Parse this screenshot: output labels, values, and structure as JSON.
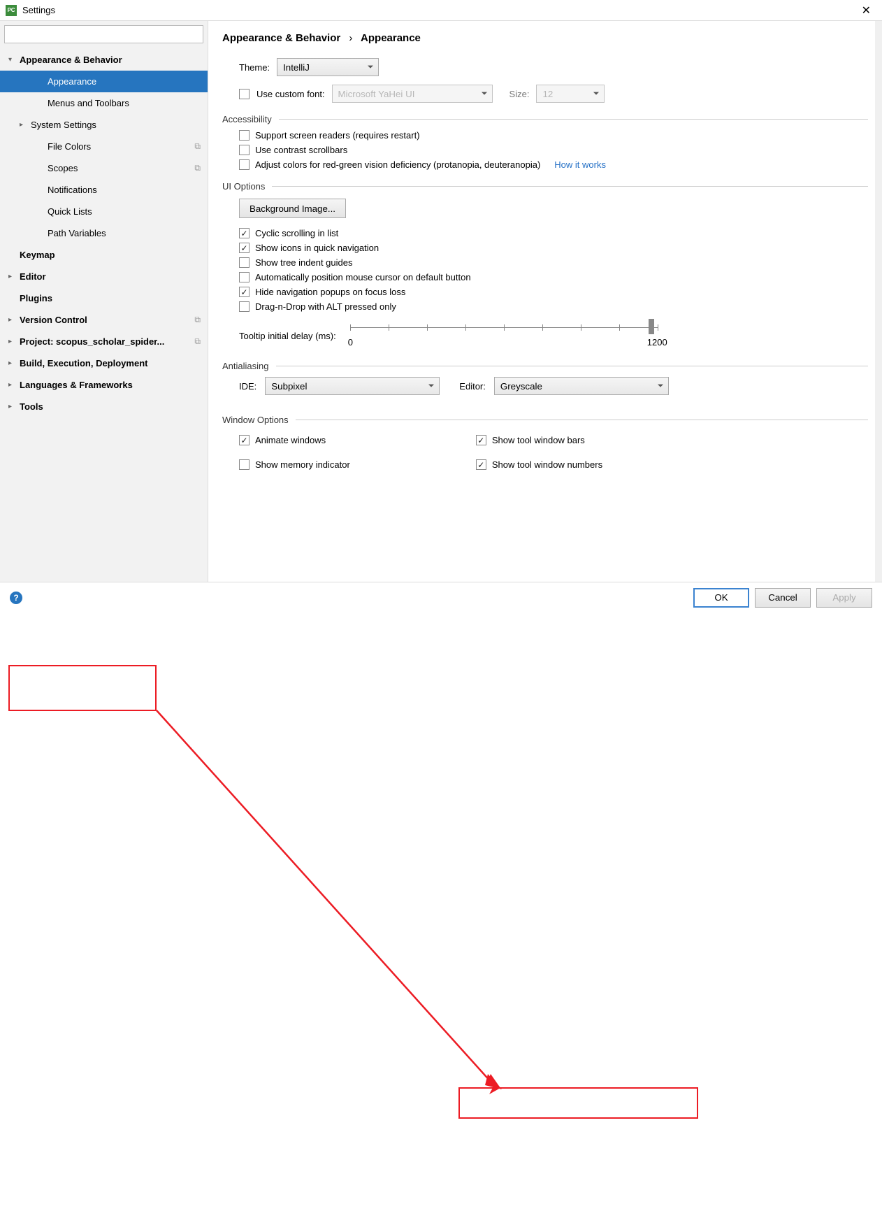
{
  "window": {
    "title": "Settings"
  },
  "search": {
    "placeholder": ""
  },
  "sidebar": {
    "items": [
      {
        "label": "Appearance & Behavior",
        "bold": true,
        "arrow": "down",
        "level": 0
      },
      {
        "label": "Appearance",
        "level": 2,
        "selected": true
      },
      {
        "label": "Menus and Toolbars",
        "level": 2
      },
      {
        "label": "System Settings",
        "arrow": "right",
        "level": 1
      },
      {
        "label": "File Colors",
        "level": 2,
        "badge": true
      },
      {
        "label": "Scopes",
        "level": 2,
        "badge": true
      },
      {
        "label": "Notifications",
        "level": 2
      },
      {
        "label": "Quick Lists",
        "level": 2
      },
      {
        "label": "Path Variables",
        "level": 2
      },
      {
        "label": "Keymap",
        "bold": true,
        "level": 0,
        "arrow": "none"
      },
      {
        "label": "Editor",
        "bold": true,
        "arrow": "right",
        "level": 0
      },
      {
        "label": "Plugins",
        "bold": true,
        "level": 0,
        "arrow": "none"
      },
      {
        "label": "Version Control",
        "bold": true,
        "arrow": "right",
        "level": 0,
        "badge": true
      },
      {
        "label": "Project: scopus_scholar_spider...",
        "bold": true,
        "arrow": "right",
        "level": 0,
        "badge": true
      },
      {
        "label": "Build, Execution, Deployment",
        "bold": true,
        "arrow": "right",
        "level": 0
      },
      {
        "label": "Languages & Frameworks",
        "bold": true,
        "arrow": "right",
        "level": 0
      },
      {
        "label": "Tools",
        "bold": true,
        "arrow": "right",
        "level": 0
      }
    ]
  },
  "breadcrumb": {
    "parent": "Appearance & Behavior",
    "sep": "›",
    "current": "Appearance"
  },
  "theme": {
    "label": "Theme:",
    "value": "IntelliJ"
  },
  "customFont": {
    "label": "Use custom font:",
    "font": "Microsoft YaHei UI",
    "sizeLabel": "Size:",
    "size": "12"
  },
  "sections": {
    "accessibility": {
      "title": "Accessibility",
      "supportReaders": "Support screen readers (requires restart)",
      "contrastScroll": "Use contrast scrollbars",
      "adjustColors": "Adjust colors for red-green vision deficiency (protanopia, deuteranopia)",
      "howItWorks": "How it works"
    },
    "uiOptions": {
      "title": "UI Options",
      "bgImage": "Background Image...",
      "cyclic": "Cyclic scrolling in list",
      "icons": "Show icons in quick navigation",
      "treeIndent": "Show tree indent guides",
      "autoCursor": "Automatically position mouse cursor on default button",
      "hideNav": "Hide navigation popups on focus loss",
      "dragDrop": "Drag-n-Drop with ALT pressed only",
      "tooltipLabel": "Tooltip initial delay (ms):",
      "sliderMin": "0",
      "sliderMax": "1200"
    },
    "antialiasing": {
      "title": "Antialiasing",
      "ideLabel": "IDE:",
      "ideValue": "Subpixel",
      "editorLabel": "Editor:",
      "editorValue": "Greyscale"
    },
    "windowOptions": {
      "title": "Window Options",
      "animate": "Animate windows",
      "memory": "Show memory indicator",
      "toolBars": "Show tool window bars",
      "toolNumbers": "Show tool window numbers"
    }
  },
  "footer": {
    "ok": "OK",
    "cancel": "Cancel",
    "apply": "Apply"
  }
}
